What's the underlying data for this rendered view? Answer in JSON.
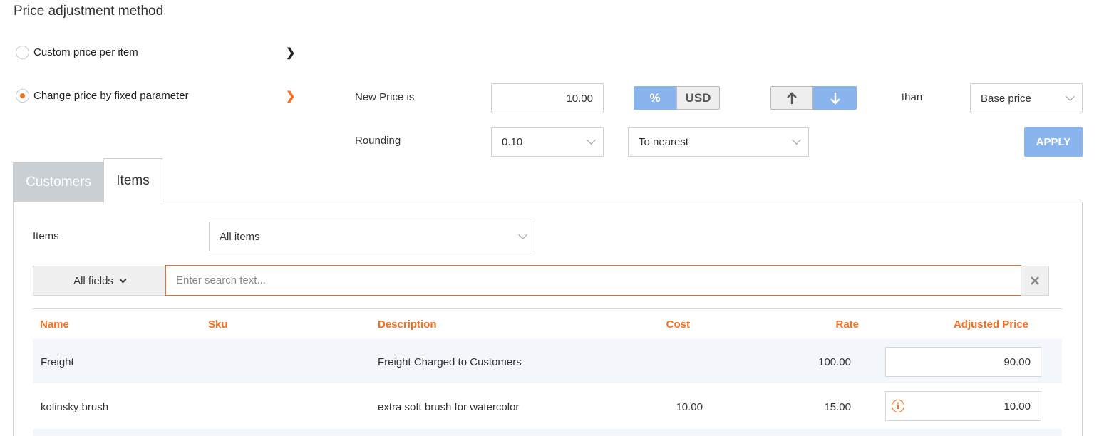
{
  "section": {
    "title": "Price adjustment method"
  },
  "methods": [
    {
      "label": "Custom price per item",
      "selected": false,
      "icon": "chevron-right-icon"
    },
    {
      "label": "Change price by fixed parameter",
      "selected": true,
      "icon": "chevron-right-icon"
    }
  ],
  "adjustment": {
    "new_price_label": "New Price is",
    "new_price_value": "10.00",
    "unit_toggle": {
      "percent": "%",
      "currency": "USD",
      "selected": "percent"
    },
    "direction_toggle": {
      "up_icon": "arrow-up-icon",
      "down_icon": "arrow-down-icon",
      "selected": "down"
    },
    "than_label": "than",
    "base_select": "Base price",
    "rounding_label": "Rounding",
    "rounding_value": "0.10",
    "rounding_mode": "To nearest",
    "apply_label": "APPLY"
  },
  "tabs": [
    {
      "label": "Customers",
      "active": false
    },
    {
      "label": "Items",
      "active": true
    }
  ],
  "items_filter": {
    "label": "Items",
    "select_value": "All items"
  },
  "search": {
    "field_label": "All fields",
    "placeholder": "Enter search text...",
    "clear_icon": "close-icon"
  },
  "table": {
    "headers": {
      "name": "Name",
      "sku": "Sku",
      "description": "Description",
      "cost": "Cost",
      "rate": "Rate",
      "adjusted": "Adjusted Price"
    },
    "rows": [
      {
        "name": "Freight",
        "sku": "",
        "description": "Freight Charged to Customers",
        "cost": "",
        "rate": "100.00",
        "adjusted": "90.00",
        "warning": false
      },
      {
        "name": "kolinsky brush",
        "sku": "",
        "description": "extra soft brush for watercolor",
        "cost": "10.00",
        "rate": "15.00",
        "adjusted": "10.00",
        "warning": true
      }
    ]
  },
  "colors": {
    "accent": "#f36f21",
    "primary": "#8ab4ee",
    "row_stripe": "#f3f6fa"
  }
}
